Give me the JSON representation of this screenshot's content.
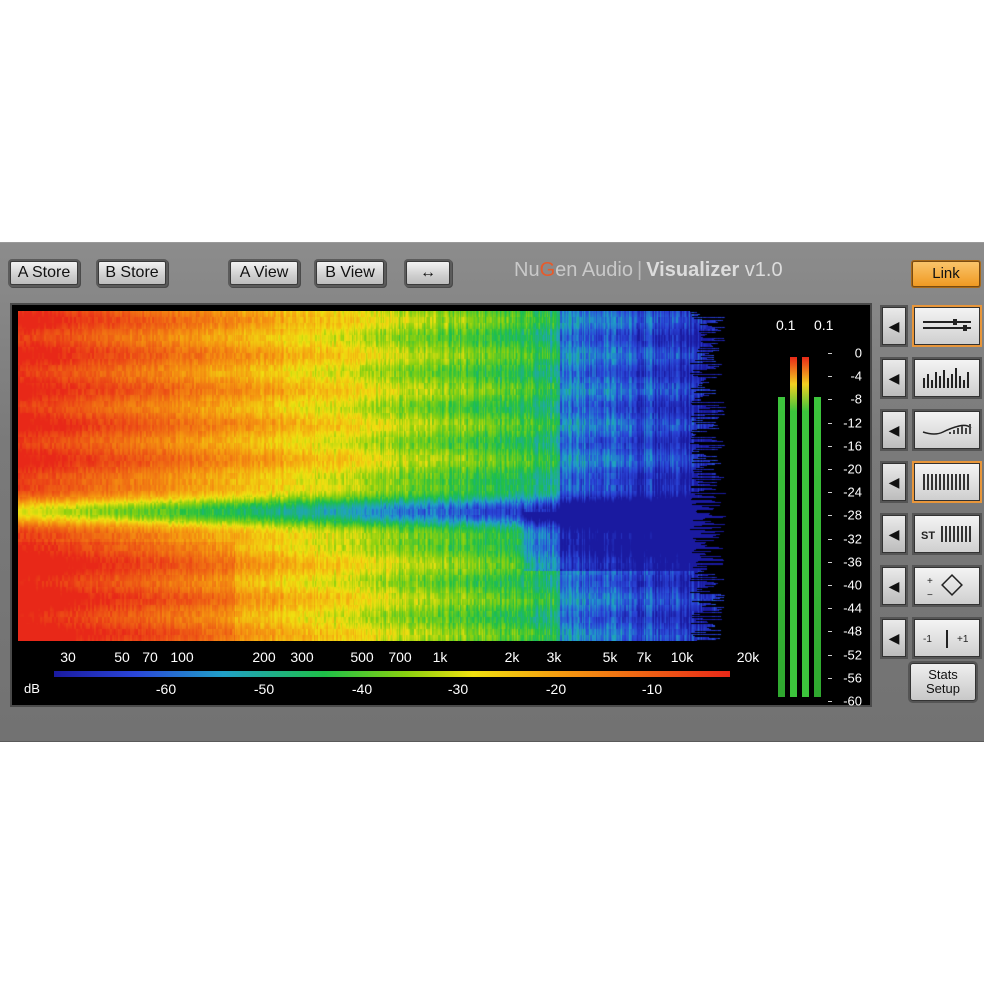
{
  "toolbar": {
    "a_store": "A Store",
    "b_store": "B Store",
    "a_view": "A View",
    "b_view": "B View",
    "swap_icon": "↔"
  },
  "brand": {
    "company_a": "Nu",
    "company_g": "G",
    "company_b": "en Audio",
    "separator": "|",
    "product": "Visualizer",
    "version": "v1.0"
  },
  "link_label": "Link",
  "spectrogram": {
    "freq_ticks": [
      "30",
      "50",
      "70",
      "100",
      "200",
      "300",
      "500",
      "700",
      "1k",
      "2k",
      "3k",
      "5k",
      "7k",
      "10k",
      "20k"
    ],
    "db_label": "dB",
    "colorbar_ticks": [
      "-60",
      "-50",
      "-40",
      "-30",
      "-20",
      "-10"
    ]
  },
  "meter": {
    "peak_left": "0.1",
    "peak_right": "0.1",
    "scale": [
      "0",
      "-4",
      "-8",
      "-12",
      "-16",
      "-20",
      "-24",
      "-28",
      "-32",
      "-36",
      "-40",
      "-44",
      "-48",
      "-52",
      "-56",
      "-60"
    ]
  },
  "sidebar": {
    "arrow_icon": "◀",
    "buttons": [
      {
        "name": "spectrum-lines-view-icon",
        "active": true
      },
      {
        "name": "bars-view-icon",
        "active": false
      },
      {
        "name": "curve-view-icon",
        "active": false
      },
      {
        "name": "spectrogram-view-icon",
        "active": true
      },
      {
        "name": "stereo-view-icon",
        "active": false
      },
      {
        "name": "phase-view-icon",
        "active": false
      },
      {
        "name": "correlation-view-icon",
        "active": false
      }
    ],
    "st_label": "ST",
    "corr_left": "-1",
    "corr_right": "+1",
    "plus_minus": "+−",
    "stats_line1": "Stats",
    "stats_line2": "Setup"
  },
  "colors": {
    "accent": "#f0a030",
    "hot": "#e82818",
    "cold": "#2a45d8",
    "meter_green": "#3cc43c"
  }
}
